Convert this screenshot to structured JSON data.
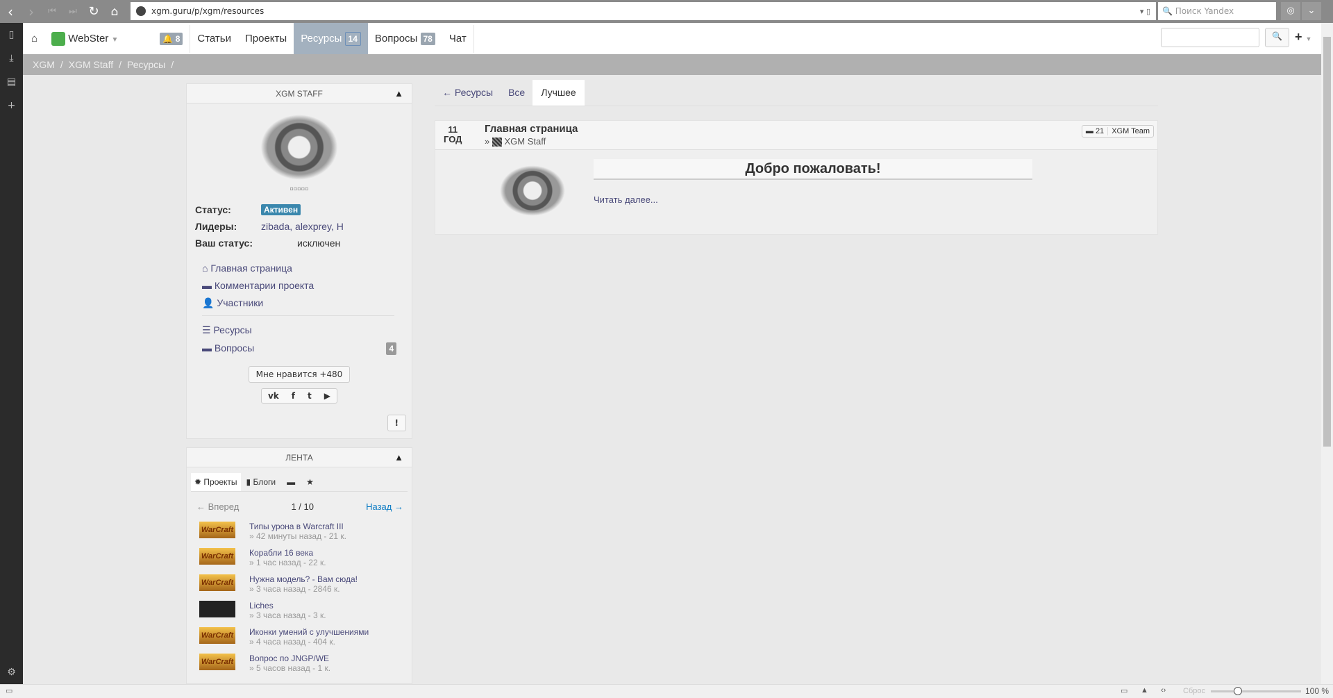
{
  "browser": {
    "url": "xgm.guru/p/xgm/resources",
    "search_placeholder": "Поиск Yandex"
  },
  "nav": {
    "user": "WebSter",
    "notifications": "8",
    "items": [
      {
        "label": "Статьи"
      },
      {
        "label": "Проекты"
      },
      {
        "label": "Ресурсы",
        "badge": "14"
      },
      {
        "label": "Вопросы",
        "badge": "78"
      },
      {
        "label": "Чат"
      }
    ]
  },
  "breadcrumb": [
    "XGM",
    "/",
    "XGM Staff",
    "/",
    "Ресурсы",
    "/"
  ],
  "project": {
    "title": "XGM STAFF",
    "status_label": "Статус:",
    "status": "Активен",
    "leaders_label": "Лидеры:",
    "leaders": "zibada, alexprey, H",
    "your_status_label": "Ваш статус:",
    "your_status": "исключен",
    "links": [
      "Главная страница",
      "Комментарии проекта",
      "Участники"
    ],
    "resources": "Ресурсы",
    "questions": "Вопросы",
    "questions_count": "4",
    "like": "Мне нравится +480",
    "report": "!"
  },
  "feed": {
    "title": "ЛЕНТА",
    "tabs": [
      "Проекты",
      "Блоги"
    ],
    "prev": "← Вперед",
    "page": "1 / 10",
    "next": "Назад →",
    "items": [
      {
        "title": "Типы урона в Warcraft III",
        "meta": "» 42 минуты назад - 21 к."
      },
      {
        "title": "Корабли 16 века",
        "meta": "» 1 час назад - 22 к."
      },
      {
        "title": "Нужна модель? - Вам сюда!",
        "meta": "» 3 часа назад - 2846 к."
      },
      {
        "title": "Liches",
        "meta": "» 3 часа назад - 3 к."
      },
      {
        "title": "Иконки умений с улучшениями",
        "meta": "» 4 часа назад - 404 к."
      },
      {
        "title": "Вопрос по JNGP/WE",
        "meta": "» 5 часов назад - 1 к."
      }
    ]
  },
  "tabs": {
    "back": "← Ресурсы",
    "all": "Все",
    "best": "Лучшее"
  },
  "post": {
    "age_num": "11",
    "age_unit": "ГОД",
    "title": "Главная страница",
    "prefix": "»",
    "project": "XGM Staff",
    "comments": "21",
    "team": "XGM Team",
    "heading": "Добро пожаловать!",
    "read_more": "Читать далее..."
  },
  "statusbar": {
    "reset": "Сброс",
    "zoom": "100 %",
    "zoom_fraction": 0.3
  }
}
